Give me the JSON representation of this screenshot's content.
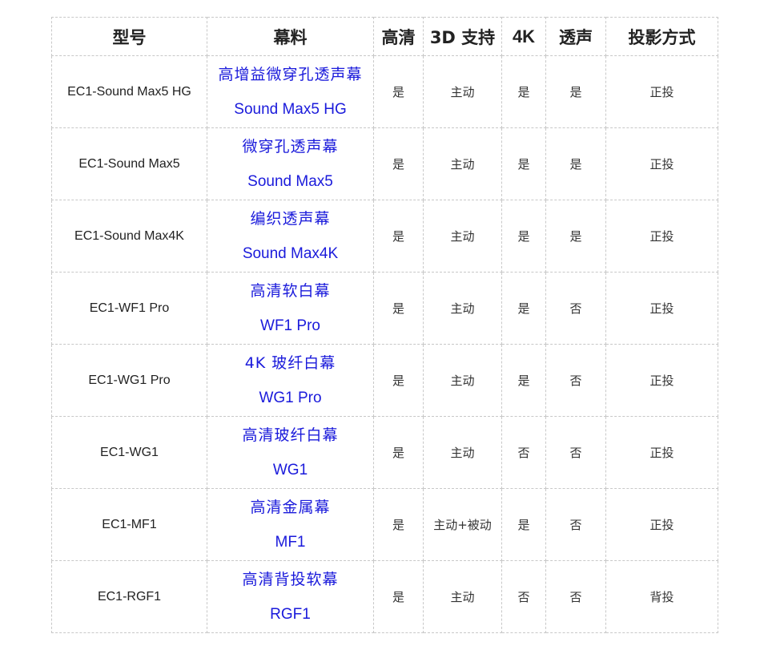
{
  "table": {
    "headers": {
      "model": "型号",
      "fabric": "幕料",
      "hd": "高清",
      "threed": "3D 支持",
      "fourk": "4K",
      "acoustic": "透声",
      "projection": "投影方式"
    },
    "rows": [
      {
        "model": "EC1-Sound Max5 HG",
        "fabric_cn": "高增益微穿孔透声幕",
        "fabric_en": "Sound Max5 HG",
        "hd": "是",
        "threed": "主动",
        "fourk": "是",
        "acoustic": "是",
        "projection": "正投"
      },
      {
        "model": "EC1-Sound Max5",
        "fabric_cn": "微穿孔透声幕",
        "fabric_en": "Sound Max5",
        "hd": "是",
        "threed": "主动",
        "fourk": "是",
        "acoustic": "是",
        "projection": "正投"
      },
      {
        "model": "EC1-Sound Max4K",
        "fabric_cn": "编织透声幕",
        "fabric_en": "Sound Max4K",
        "hd": "是",
        "threed": "主动",
        "fourk": "是",
        "acoustic": "是",
        "projection": "正投"
      },
      {
        "model": "EC1-WF1 Pro",
        "fabric_cn": "高清软白幕",
        "fabric_en": "WF1 Pro",
        "hd": "是",
        "threed": "主动",
        "fourk": "是",
        "acoustic": "否",
        "projection": "正投"
      },
      {
        "model": "EC1-WG1 Pro",
        "fabric_cn": "4K 玻纤白幕",
        "fabric_en": "WG1 Pro",
        "hd": "是",
        "threed": "主动",
        "fourk": "是",
        "acoustic": "否",
        "projection": "正投"
      },
      {
        "model": "EC1-WG1",
        "fabric_cn": "高清玻纤白幕",
        "fabric_en": "WG1",
        "hd": "是",
        "threed": "主动",
        "fourk": "否",
        "acoustic": "否",
        "projection": "正投"
      },
      {
        "model": "EC1-MF1",
        "fabric_cn": "高清金属幕",
        "fabric_en": "MF1",
        "hd": "是",
        "threed": "主动+被动",
        "fourk": "是",
        "acoustic": "否",
        "projection": "正投"
      },
      {
        "model": "EC1-RGF1",
        "fabric_cn": "高清背投软幕",
        "fabric_en": "RGF1",
        "hd": "是",
        "threed": "主动",
        "fourk": "否",
        "acoustic": "否",
        "projection": "背投"
      }
    ]
  }
}
